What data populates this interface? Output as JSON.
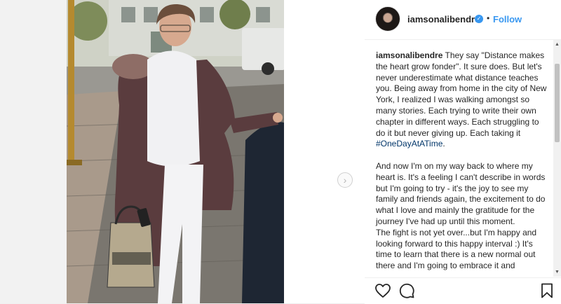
{
  "post": {
    "username": "iamsonalibendre",
    "verified_icon": "verified-badge-icon",
    "separator": "•",
    "follow_label": "Follow",
    "caption": {
      "author": "iamsonalibendre",
      "para1": "They say \"Distance makes the heart grow fonder\". It sure does. But let's never underestimate what distance teaches you. Being away from home in the city of New York, I realized I was walking amongst so many stories. Each trying to write their own chapter in different ways. Each struggling to do it but never giving up. Each taking it",
      "hashtag": "#OneDayAtATime",
      "para1_end": ".",
      "para2": "And now I'm on my way back to where my heart is. It's a feeling I can't describe in words but I'm going to try - it's the joy to see my family and friends again, the excitement to do what I love and mainly the gratitude for the journey I've had up until this moment.",
      "para3": "The fight is not yet over...but I'm happy and looking forward to this happy interval :) It's time to learn that there is a new normal out there and I'm going to embrace it and"
    }
  },
  "icons": {
    "next": "chevron-right-icon",
    "like": "heart-icon",
    "comment": "comment-icon",
    "save": "bookmark-icon"
  }
}
